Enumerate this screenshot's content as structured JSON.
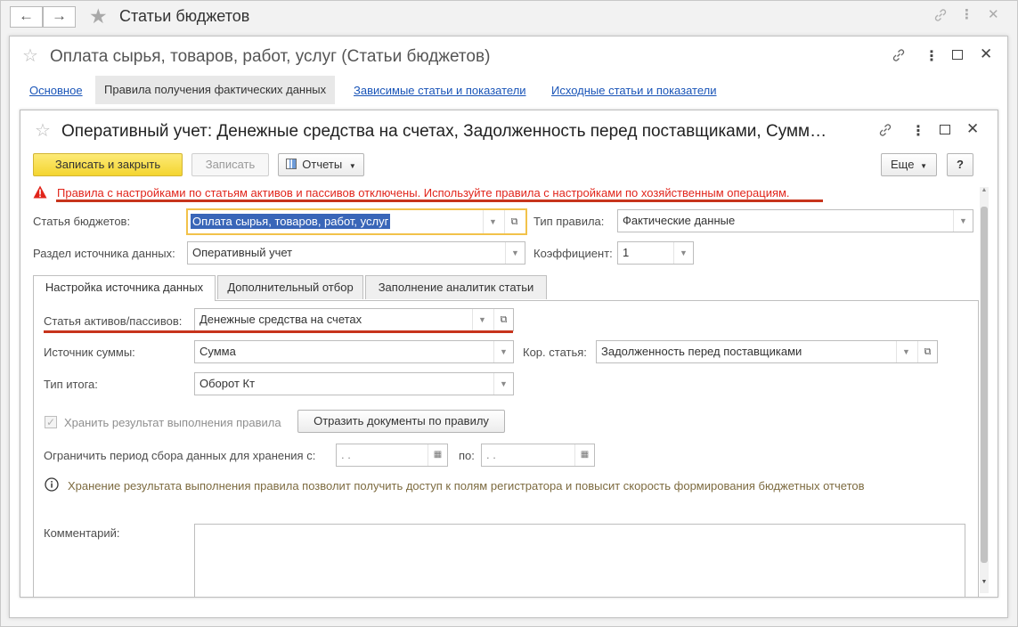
{
  "app": {
    "title": "Статьи бюджетов",
    "back_icon": "←",
    "forward_icon": "→"
  },
  "form1": {
    "title": "Оплата сырья, товаров, работ, услуг (Статьи бюджетов)",
    "tabs": [
      {
        "label": "Основное"
      },
      {
        "label": "Правила получения фактических данных"
      },
      {
        "label": "Зависимые статьи и показатели"
      },
      {
        "label": "Исходные статьи и показатели"
      }
    ]
  },
  "form2": {
    "title": "Оперативный учет: Денежные средства на счетах, Задолженность перед поставщиками, Сумм…",
    "toolbar": {
      "save_close": "Записать и закрыть",
      "save": "Записать",
      "reports": "Отчеты",
      "more": "Еще",
      "help": "?"
    },
    "warning": "Правила с настройками по статьям активов и пассивов отключены. Используйте правила с настройками по хозяйственным операциям.",
    "fields": {
      "budget_item_label": "Статья бюджетов:",
      "budget_item_value": "Оплата сырья, товаров, работ, услуг",
      "rule_type_label": "Тип правила:",
      "rule_type_value": "Фактические данные",
      "source_section_label": "Раздел источника данных:",
      "source_section_value": "Оперативный учет",
      "coef_label": "Коэффициент:",
      "coef_value": "1"
    },
    "inner_tabs": [
      {
        "label": "Настройка источника данных"
      },
      {
        "label": "Дополнительный отбор"
      },
      {
        "label": "Заполнение аналитик статьи"
      }
    ],
    "panel": {
      "asset_label": "Статья активов/пассивов:",
      "asset_value": "Денежные средства на счетах",
      "sum_source_label": "Источник суммы:",
      "sum_source_value": "Сумма",
      "corr_label": "Кор. статья:",
      "corr_value": "Задолженность перед поставщиками",
      "total_type_label": "Тип итога:",
      "total_type_value": "Оборот Кт",
      "store_result_label": "Хранить результат выполнения правила",
      "reflect_docs_button": "Отразить документы по правилу",
      "limit_period_label": "Ограничить период сбора данных для хранения с:",
      "date_from": " .  .",
      "to_label": "по:",
      "date_to": " .  .",
      "info_text": "Хранение результата выполнения правила позволит получить доступ к полям регистратора и повысит скорость формирования бюджетных отчетов",
      "comment_label": "Комментарий:"
    }
  },
  "colors": {
    "accent_link": "#1a55b8",
    "warning_red": "#e1251b",
    "highlight_red": "#c7341c",
    "focus_yellow": "#f2c24a",
    "selection_blue": "#3966b8",
    "primary_button": "#f4d530"
  }
}
